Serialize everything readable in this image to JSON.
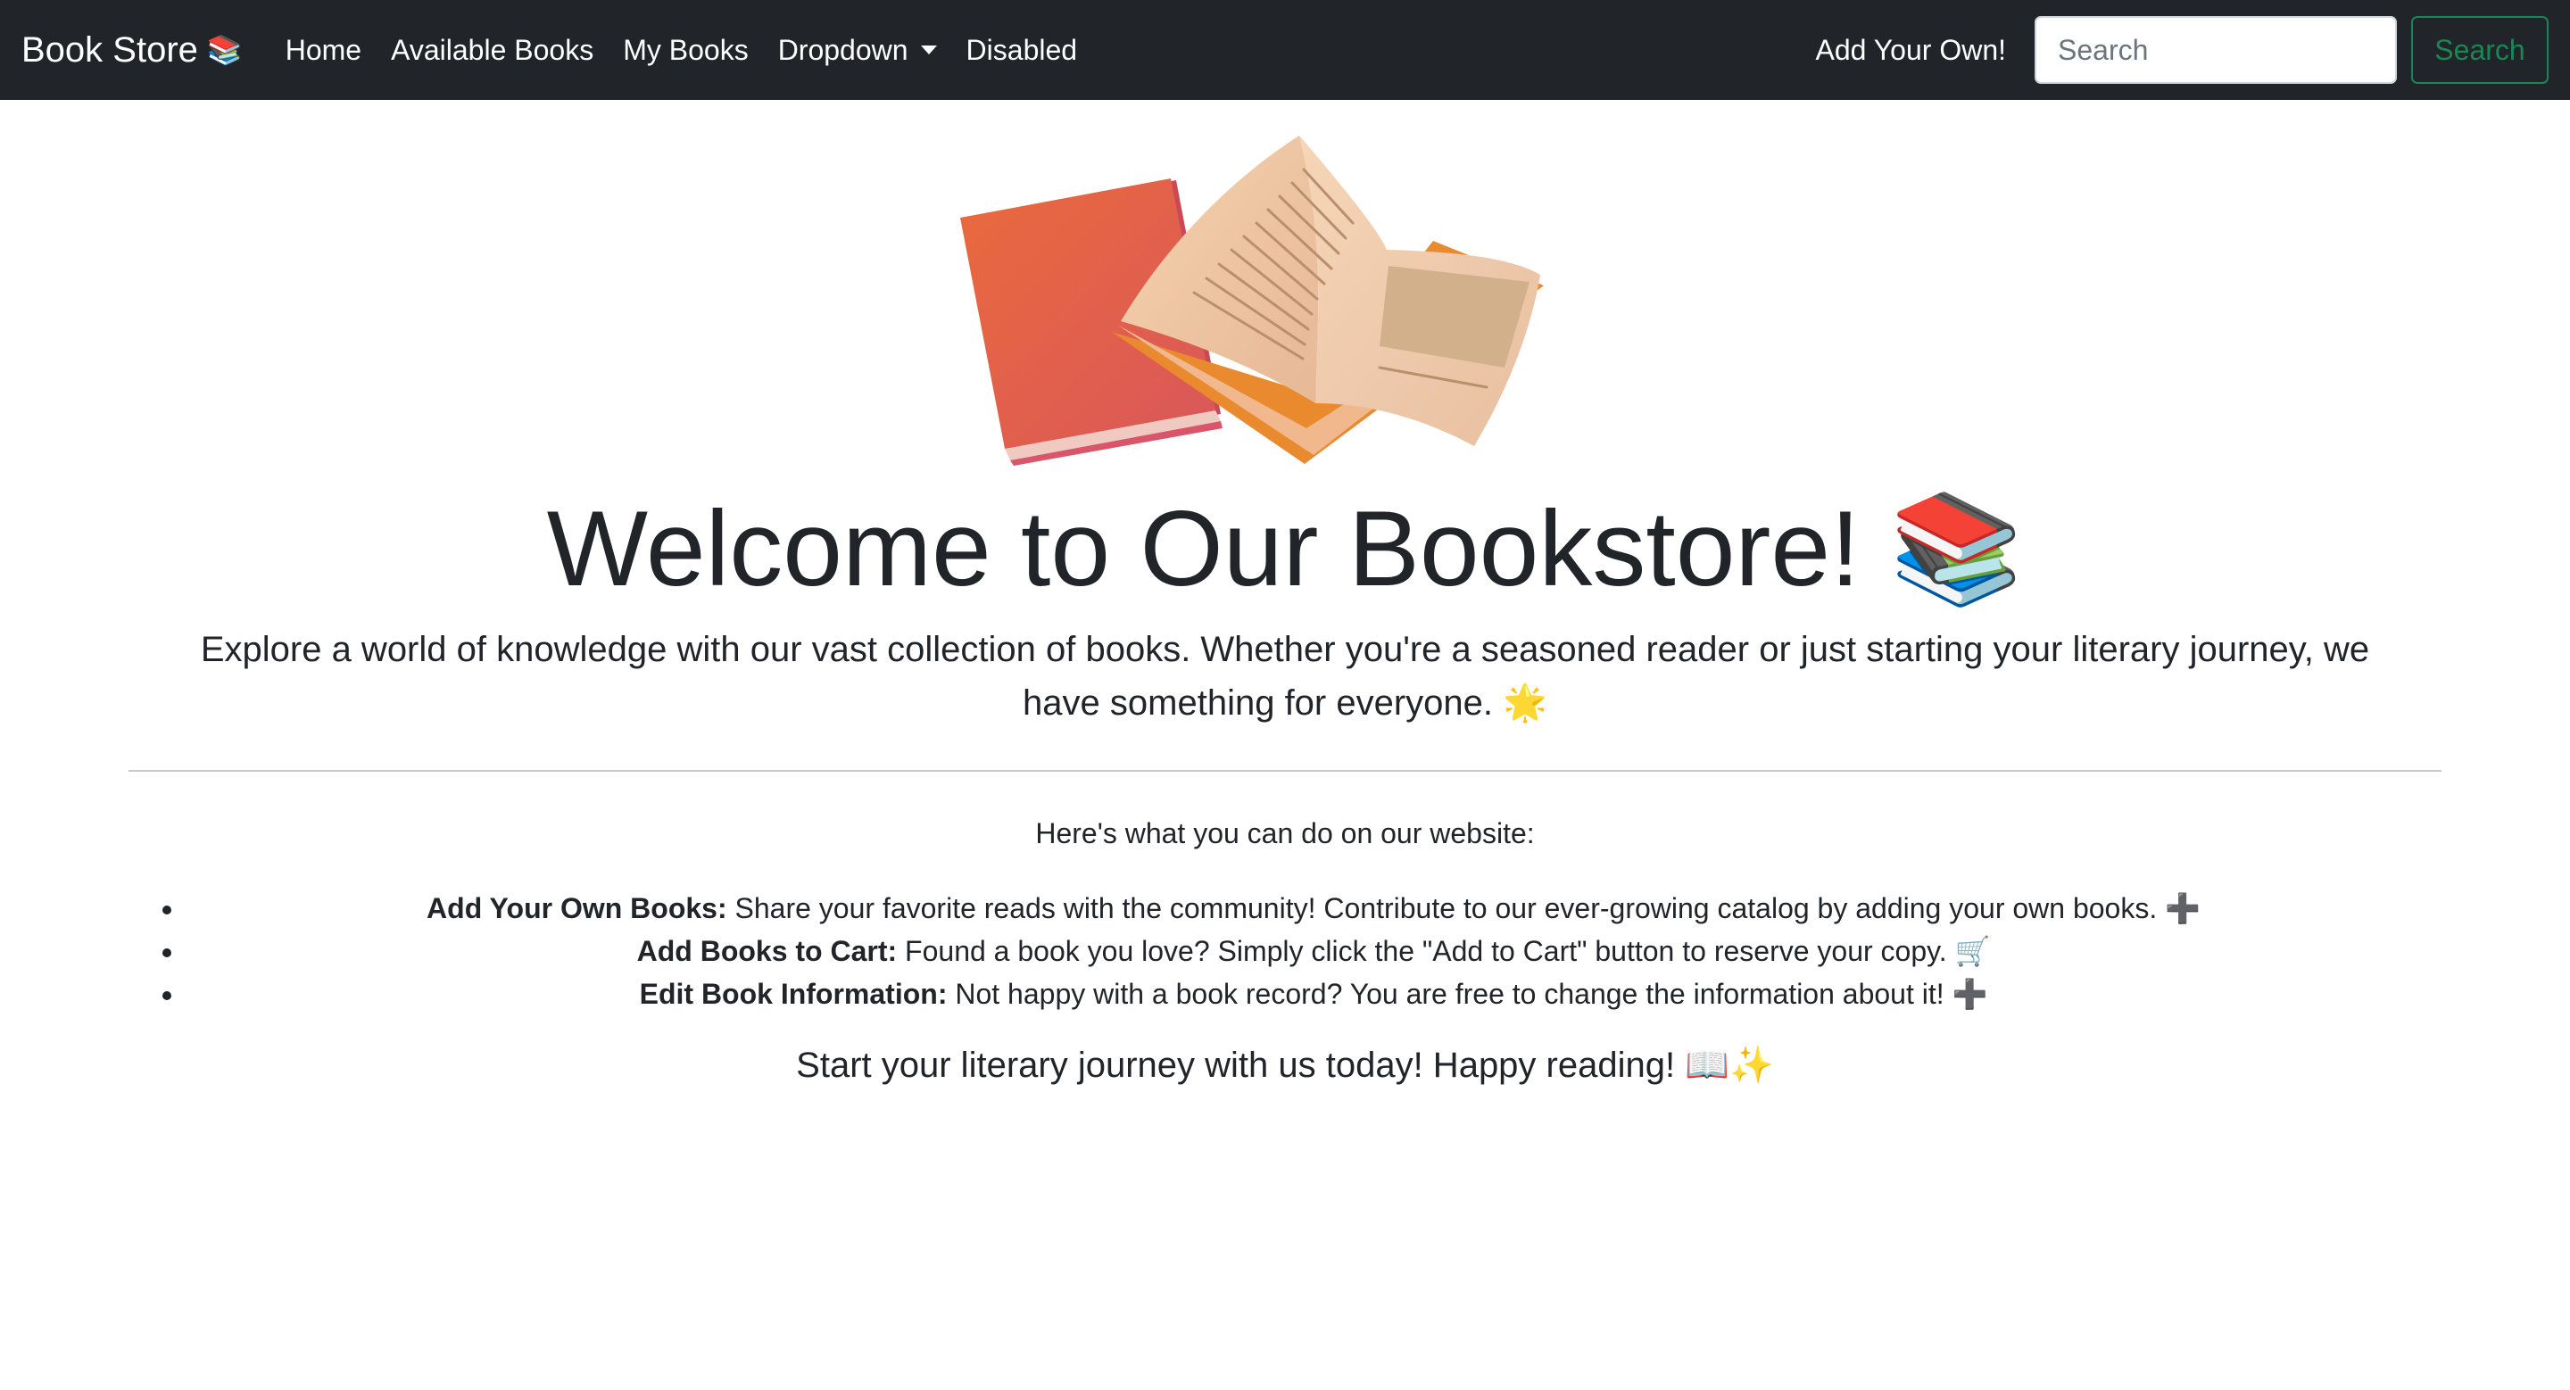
{
  "navbar": {
    "brand": "Book Store",
    "brand_emoji": "📚",
    "links": [
      "Home",
      "Available Books",
      "My Books",
      "Dropdown",
      "Disabled"
    ],
    "add_own": "Add Your Own!",
    "search_placeholder": "Search",
    "search_button": "Search"
  },
  "hero": {
    "title": "Welcome to Our Bookstore!",
    "title_emoji": "📚",
    "lead": "Explore a world of knowledge with our vast collection of books. Whether you're a seasoned reader or just starting your literary journey, we have something for everyone. 🌟"
  },
  "features": {
    "heading": "Here's what you can do on our website:",
    "items": [
      {
        "title": "Add Your Own Books:",
        "text": " Share your favorite reads with the community! Contribute to our ever-growing catalog by adding your own books. ➕"
      },
      {
        "title": "Add Books to Cart:",
        "text": " Found a book you love? Simply click the \"Add to Cart\" button to reserve your copy. 🛒"
      },
      {
        "title": "Edit Book Information:",
        "text": " Not happy with a book record? You are free to change the information about it! ➕"
      }
    ]
  },
  "closing": "Start your literary journey with us today! Happy reading! 📖✨",
  "colors": {
    "navbar_bg": "#212529",
    "success": "#198754",
    "text": "#212529"
  }
}
